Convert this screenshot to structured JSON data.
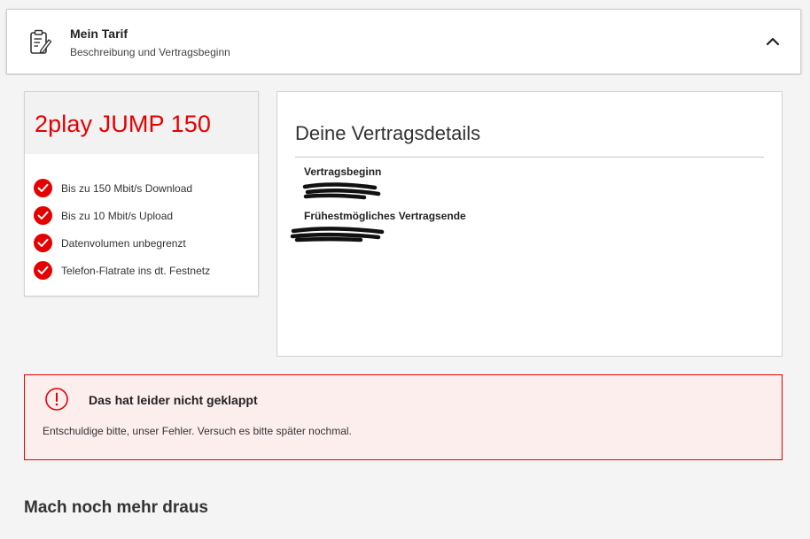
{
  "header": {
    "title": "Mein Tarif",
    "subtitle": "Beschreibung und Vertragsbeginn",
    "icon": "clipboard-pen-icon",
    "toggle_icon": "chevron-up-icon"
  },
  "tariff": {
    "name": "2play JUMP 150",
    "features": [
      "Bis zu 150 Mbit/s Download",
      "Bis zu 10 Mbit/s Upload",
      "Datenvolumen unbegrenzt",
      "Telefon-Flatrate ins dt. Festnetz"
    ]
  },
  "details": {
    "title": "Deine Vertragsdetails",
    "start_label": "Vertragsbeginn",
    "end_label": "Frühestmögliches Vertragsende"
  },
  "error": {
    "title": "Das hat leider nicht geklappt",
    "message": "Entschuldige bitte, unser Fehler. Versuch es bitte später nochmal."
  },
  "more": {
    "title": "Mach noch mehr draus"
  },
  "colors": {
    "brand_red": "#e60000",
    "error_bg": "#fdeeee"
  }
}
